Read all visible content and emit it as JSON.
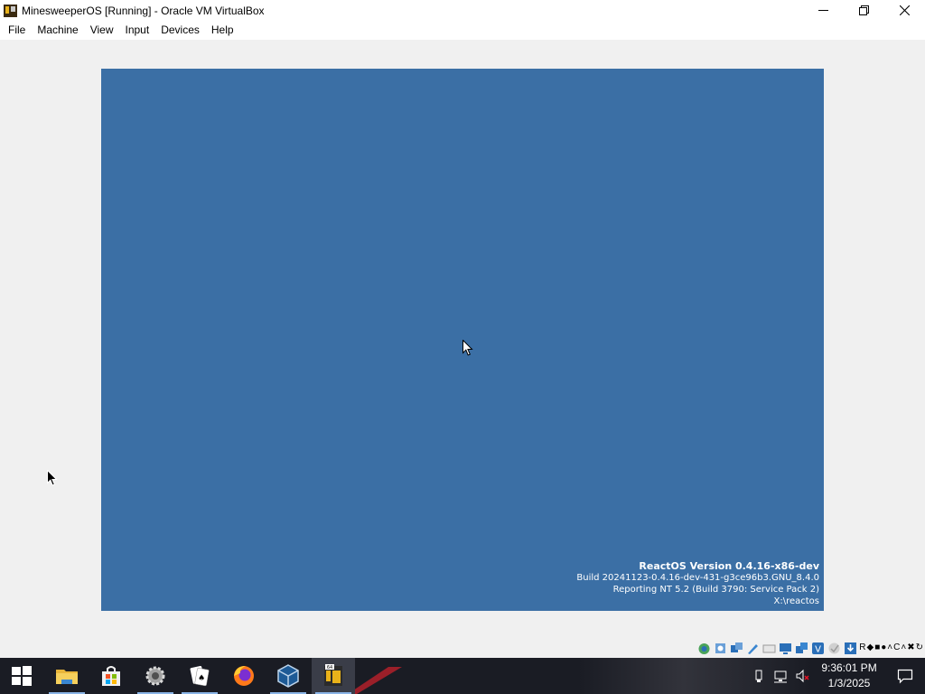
{
  "window": {
    "title": "MinesweeperOS [Running] - Oracle VM VirtualBox",
    "minimize_icon": "minimize-icon",
    "restore_icon": "restore-icon",
    "close_icon": "close-icon"
  },
  "menu": {
    "items": [
      {
        "label": "File"
      },
      {
        "label": "Machine"
      },
      {
        "label": "View"
      },
      {
        "label": "Input"
      },
      {
        "label": "Devices"
      },
      {
        "label": "Help"
      }
    ]
  },
  "guest": {
    "background_color": "#3b6fa5",
    "version_line": "ReactOS Version 0.4.16-x86-dev",
    "build_line": "Build 20241123-0.4.16-dev-431-g3ce96b3.GNU_8.4.0",
    "reporting_line": "Reporting NT 5.2 (Build 3790: Service Pack 2)",
    "path_line": "X:\\reactos"
  },
  "statusbar": {
    "icons": [
      "hard-disk-icon",
      "optical-drive-icon",
      "audio-icon",
      "network-icon",
      "usb-icon",
      "shared-folders-icon",
      "display-icon",
      "recording-icon",
      "vrde-icon",
      "cpu-icon",
      "mouse-integration-icon",
      "keyboard-capture-icon"
    ],
    "host_key_label": "R"
  },
  "taskbar": {
    "apps": [
      {
        "name": "file-explorer",
        "icon": "folder-icon"
      },
      {
        "name": "microsoft-store",
        "icon": "store-icon"
      },
      {
        "name": "settings-app",
        "icon": "gear-icon"
      },
      {
        "name": "solitaire",
        "icon": "cards-icon"
      },
      {
        "name": "firefox",
        "icon": "firefox-icon"
      },
      {
        "name": "virtualbox",
        "icon": "virtualbox-icon"
      },
      {
        "name": "minesweeper-vm",
        "icon": "vm-window-icon"
      }
    ],
    "tray_icons": [
      "usb-eject-icon",
      "network-icon",
      "volume-muted-icon"
    ],
    "clock": {
      "time": "9:36:01 PM",
      "date": "1/3/2025"
    },
    "notification_icon": "notification-icon"
  }
}
